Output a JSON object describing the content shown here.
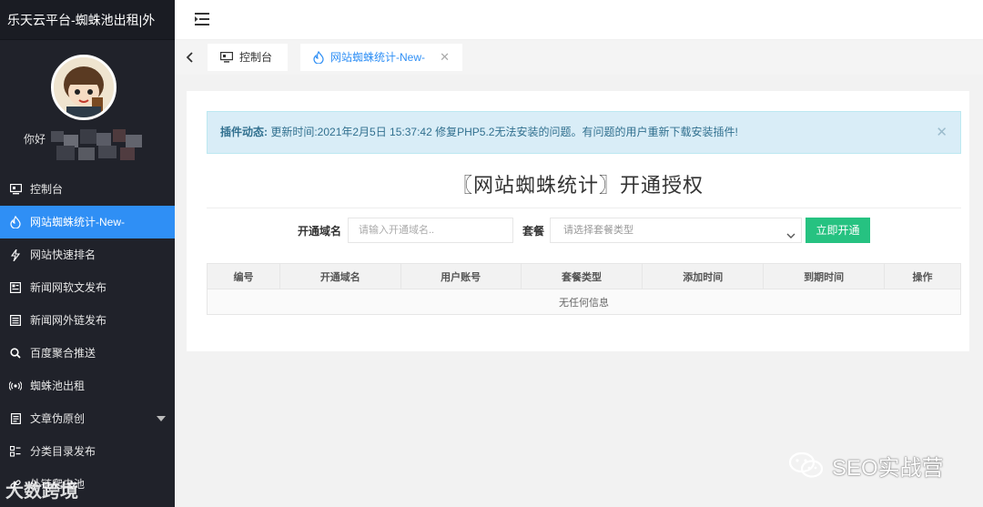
{
  "sidebar": {
    "brand": "乐天云平台-蜘蛛池出租|外",
    "greeting": "你好",
    "items": [
      {
        "label": "控制台",
        "icon": "monitor-icon",
        "active": false
      },
      {
        "label": "网站蜘蛛统计-New-",
        "icon": "fire-icon",
        "active": true
      },
      {
        "label": "网站快速排名",
        "icon": "bolt-icon",
        "active": false
      },
      {
        "label": "新闻网软文发布",
        "icon": "newspaper-icon",
        "active": false
      },
      {
        "label": "新闻网外链发布",
        "icon": "list-icon",
        "active": false
      },
      {
        "label": "百度聚合推送",
        "icon": "search-icon",
        "active": false
      },
      {
        "label": "蜘蛛池出租",
        "icon": "broadcast-icon",
        "active": false
      },
      {
        "label": "文章伪原创",
        "icon": "document-icon",
        "active": false
      },
      {
        "label": "分类目录发布",
        "icon": "category-icon",
        "active": false
      },
      {
        "label": "外链爬虫池",
        "icon": "link-icon",
        "active": false
      }
    ]
  },
  "tabs": {
    "home_label": "控制台",
    "active_label": "网站蜘蛛统计-New-"
  },
  "notice": {
    "prefix": "插件动态:",
    "text": " 更新时间:2021年2月5日 15:37:42 修复PHP5.2无法安装的问题。有问题的用户重新下载安装插件!"
  },
  "page": {
    "title": "〖网站蜘蛛统计〗开通授权"
  },
  "form": {
    "domain_label": "开通域名",
    "domain_placeholder": "请输入开通域名..",
    "plan_label": "套餐",
    "plan_placeholder": "请选择套餐类型",
    "submit_label": "立即开通"
  },
  "table": {
    "headers": [
      "编号",
      "开通域名",
      "用户账号",
      "套餐类型",
      "添加时间",
      "到期时间",
      "操作"
    ],
    "empty_text": "无任何信息"
  },
  "watermarks": {
    "right": "SEO实战营",
    "left": "大数跨境"
  },
  "colors": {
    "sidebar_bg": "#20222a",
    "active_blue": "#2f8ff5",
    "notice_bg": "#d9edf7",
    "button_green": "#26c281"
  }
}
